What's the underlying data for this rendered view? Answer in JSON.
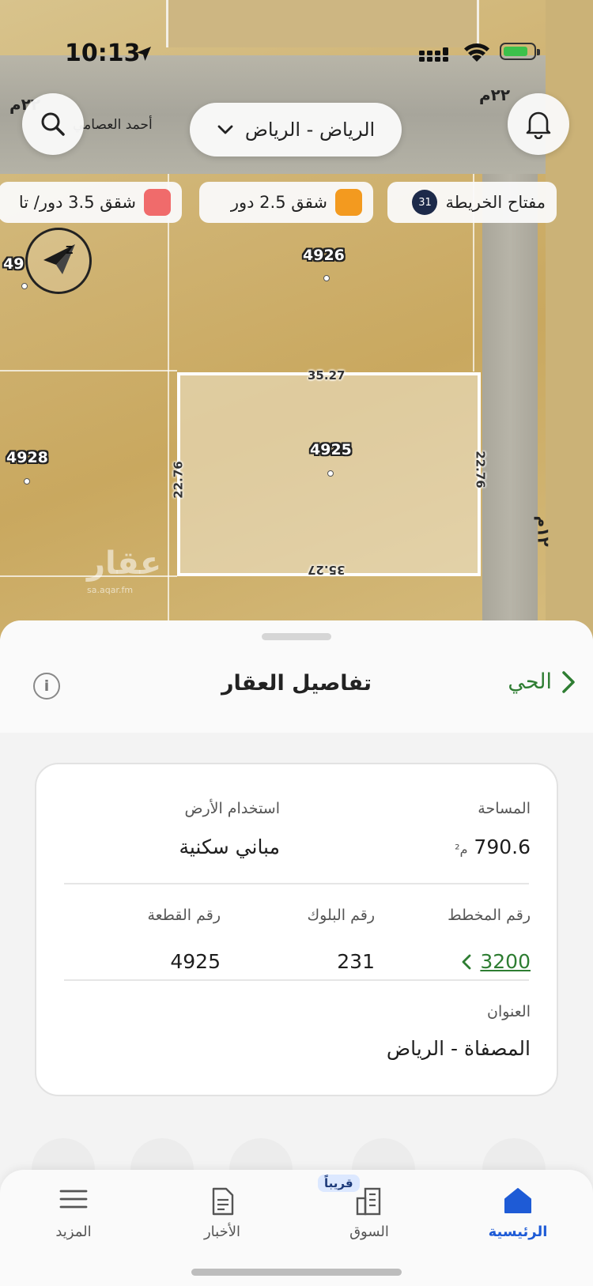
{
  "status_bar": {
    "time": "10:13"
  },
  "map": {
    "city_selector": "الرياض - الرياض",
    "legend": [
      {
        "label": "مفتاح الخريطة",
        "badge": "31"
      },
      {
        "label": "شقق 2.5 دور",
        "color": "#f39a1f"
      },
      {
        "label": "شقق 3.5 دور/ تا",
        "color": "#f06b6b"
      }
    ],
    "streets": {
      "top_left": "٢٢م",
      "top_right": "٢٢م",
      "name": "أحمد العصامي",
      "right_vertical": "١٢م"
    },
    "plots": {
      "north": "4926",
      "west": "4928",
      "selected": "4925",
      "northwest": "49"
    },
    "dimensions": {
      "top": "35.27",
      "bottom": "35.27",
      "left": "22.76",
      "right": "22.76"
    },
    "watermark": "عقار",
    "watermark_url": "sa.aqar.fm"
  },
  "sheet": {
    "title": "تفاصيل العقار",
    "district_link": "الحي",
    "area_label": "المساحة",
    "area_value": "790.6",
    "area_unit": "م²",
    "land_use_label": "استخدام الأرض",
    "land_use_value": "مباني سكنية",
    "plan_label": "رقم المخطط",
    "plan_value": "3200",
    "block_label": "رقم البلوك",
    "block_value": "231",
    "plot_label": "رقم القطعة",
    "plot_value": "4925",
    "address_label": "العنوان",
    "address_value": "المصفاة - الرياض"
  },
  "nav": {
    "home": "الرئيسية",
    "market": "السوق",
    "soon_badge": "قريباً",
    "news": "الأخبار",
    "more": "المزيد"
  },
  "colors": {
    "accent_green": "#2e7d32",
    "accent_blue": "#1e5bd6"
  }
}
